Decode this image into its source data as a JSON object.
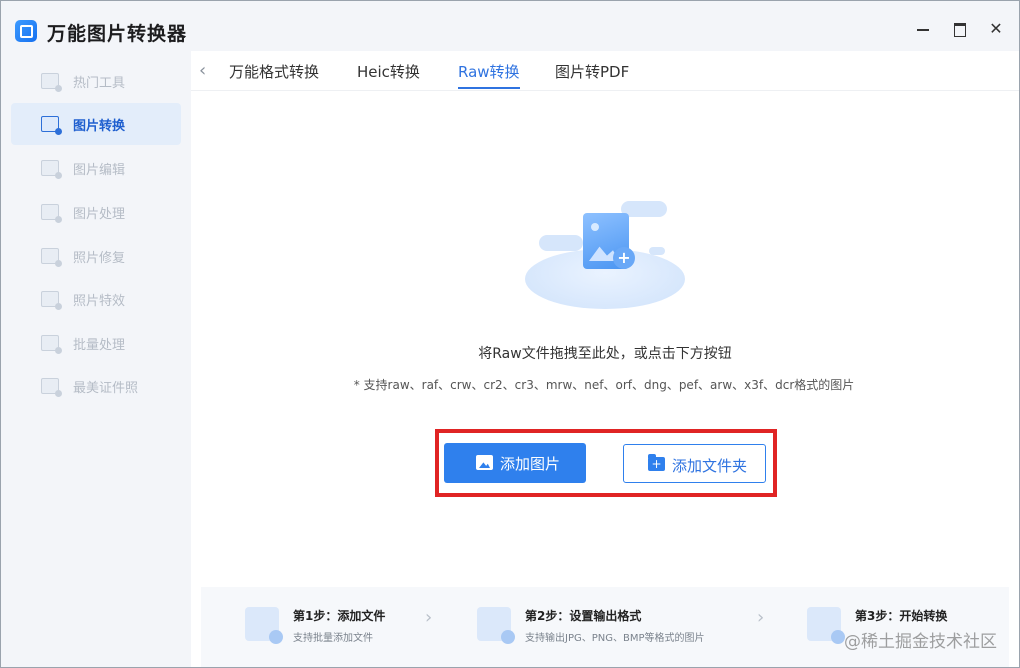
{
  "window": {
    "title": "万能图片转换器",
    "controls": {
      "minimize": "minimize",
      "maximize": "maximize",
      "close": "✕"
    }
  },
  "sidebar": {
    "items": [
      {
        "label": "热门工具",
        "icon": "hot-tools-icon",
        "active": false
      },
      {
        "label": "图片转换",
        "icon": "image-convert-icon",
        "active": true
      },
      {
        "label": "图片编辑",
        "icon": "image-edit-icon",
        "active": false
      },
      {
        "label": "图片处理",
        "icon": "image-process-icon",
        "active": false
      },
      {
        "label": "照片修复",
        "icon": "photo-repair-icon",
        "active": false
      },
      {
        "label": "照片特效",
        "icon": "photo-effects-icon",
        "active": false
      },
      {
        "label": "批量处理",
        "icon": "batch-process-icon",
        "active": false
      },
      {
        "label": "最美证件照",
        "icon": "id-photo-icon",
        "active": false
      }
    ]
  },
  "tabs": {
    "back": "‹",
    "items": [
      {
        "label": "万能格式转换",
        "active": false
      },
      {
        "label": "Heic转换",
        "active": false
      },
      {
        "label": "Raw转换",
        "active": true
      },
      {
        "label": "图片转PDF",
        "active": false
      }
    ]
  },
  "dropzone": {
    "hint": "将Raw文件拖拽至此处，或点击下方按钮",
    "formats": "* 支持raw、raf、crw、cr2、cr3、mrw、nef、orf、dng、pef、arw、x3f、dcr格式的图片",
    "add_images": "添加图片",
    "add_folder": "添加文件夹"
  },
  "steps": [
    {
      "title": "第1步：添加文件",
      "desc": "支持批量添加文件"
    },
    {
      "title": "第2步：设置输出格式",
      "desc": "支持输出JPG、PNG、BMP等格式的图片"
    },
    {
      "title": "第3步：开始转换",
      "desc": ""
    }
  ],
  "watermark": "@稀土掘金技术社区",
  "colors": {
    "accent": "#2f80ed",
    "highlight": "#e02424",
    "active_bg": "#e3edfa"
  }
}
